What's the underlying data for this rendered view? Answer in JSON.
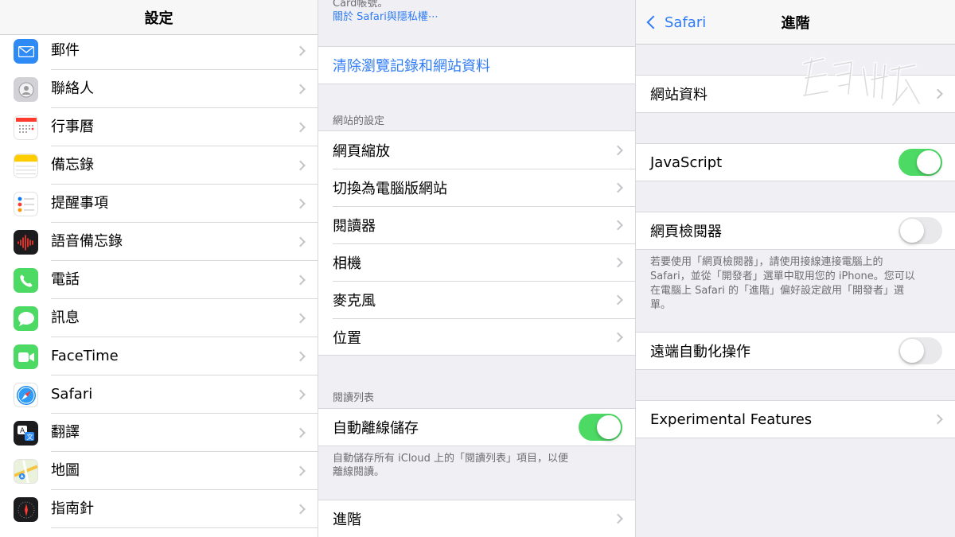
{
  "left": {
    "title": "設定",
    "items": [
      {
        "label": "",
        "icon": "partial-icon"
      },
      {
        "label": "郵件",
        "icon": "mail-icon",
        "color": "#2e8bf5"
      },
      {
        "label": "聯絡人",
        "icon": "contacts-icon",
        "color": "#c9c9ce"
      },
      {
        "label": "行事曆",
        "icon": "calendar-icon",
        "color": "#ffffff"
      },
      {
        "label": "備忘錄",
        "icon": "notes-icon",
        "color": "#ffffff"
      },
      {
        "label": "提醒事項",
        "icon": "reminders-icon",
        "color": "#ffffff"
      },
      {
        "label": "語音備忘錄",
        "icon": "voice-memos-icon",
        "color": "#1c1c1e"
      },
      {
        "label": "電話",
        "icon": "phone-icon",
        "color": "#4cd964"
      },
      {
        "label": "訊息",
        "icon": "messages-icon",
        "color": "#4cd964"
      },
      {
        "label": "FaceTime",
        "icon": "facetime-icon",
        "color": "#4cd964"
      },
      {
        "label": "Safari",
        "icon": "safari-icon",
        "color": "#ffffff"
      },
      {
        "label": "翻譯",
        "icon": "translate-icon",
        "color": "#1c1c1e"
      },
      {
        "label": "地圖",
        "icon": "maps-icon",
        "color": "#e8f0d8"
      },
      {
        "label": "指南針",
        "icon": "compass-icon",
        "color": "#1c1c1e"
      }
    ]
  },
  "middle": {
    "top_text_1": "Card帳號。",
    "top_link": "關於 Safari與隱私權⋯",
    "clear_history": "清除瀏覽記錄和網站資料",
    "section_site_settings": "網站的設定",
    "site_settings": [
      "網頁縮放",
      "切換為電腦版網站",
      "閱讀器",
      "相機",
      "麥克風",
      "位置"
    ],
    "section_reading_list": "閱讀列表",
    "auto_offline_save": "自動離線儲存",
    "auto_offline_save_on": true,
    "reading_list_footer_1": "自動儲存所有 iCloud 上的「閱讀列表」項目，以便",
    "reading_list_footer_2": "離線閱讀。",
    "advanced": "進階"
  },
  "right": {
    "back_label": "Safari",
    "title": "進階",
    "website_data": "網站資料",
    "javascript": "JavaScript",
    "javascript_on": true,
    "web_inspector": "網頁檢閱器",
    "web_inspector_on": false,
    "inspector_footer_1": "若要使用「網頁檢閱器」，請使用接線連接電腦上的",
    "inspector_footer_2": "Safari，並從「開發者」選單中取用您的 iPhone。您可以",
    "inspector_footer_3": "在電腦上 Safari 的「進階」偏好設定啟用「開發者」選",
    "inspector_footer_4": "單。",
    "remote_automation": "遠端自動化操作",
    "remote_automation_on": false,
    "experimental_features": "Experimental Features",
    "accent_color": "#2f7cf6",
    "toggle_on_color": "#4cd964"
  }
}
